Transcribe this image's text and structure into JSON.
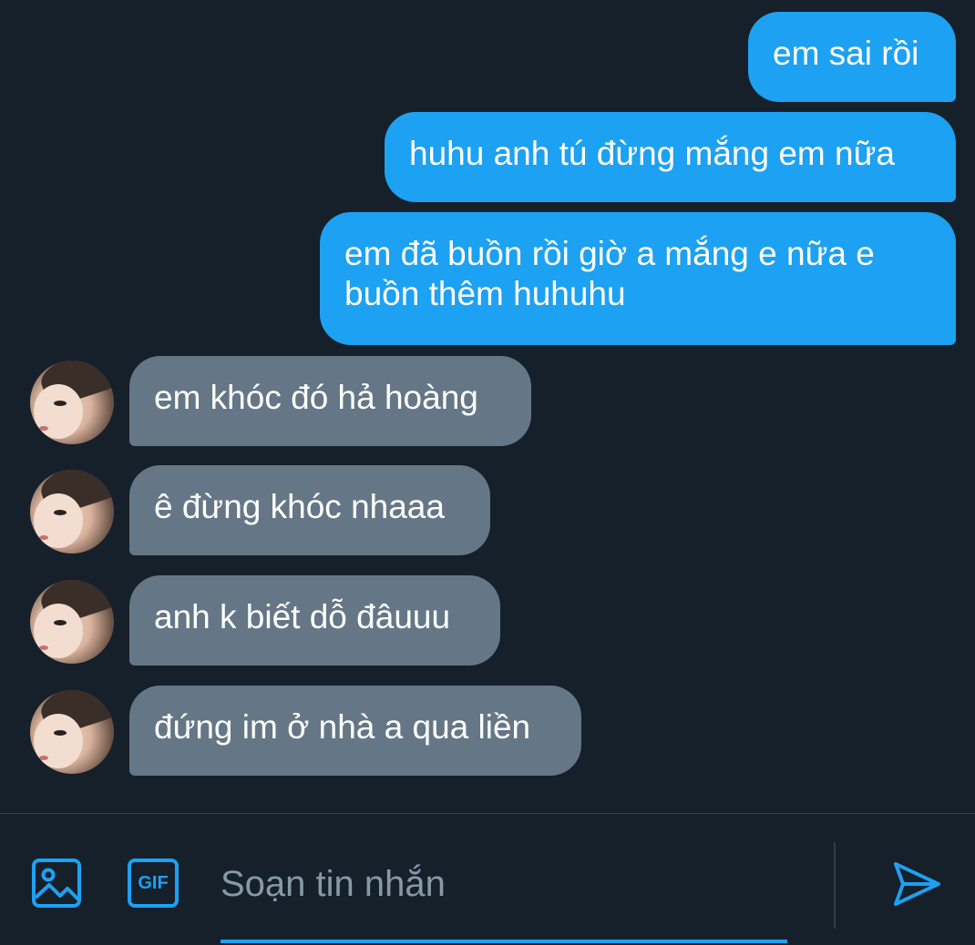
{
  "conversation": {
    "sent_messages": [
      {
        "text": "em sai rồi"
      },
      {
        "text": "huhu anh tú đừng mắng em nữa"
      },
      {
        "line1": "em đã buồn rồi giờ a mắng e nữa e",
        "line2": "buồn thêm huhuhu"
      }
    ],
    "received_messages": [
      {
        "text": "em khóc đó hả hoàng"
      },
      {
        "text": "ê đừng khóc nhaaa"
      },
      {
        "text": "anh k biết dỗ đâuuu"
      },
      {
        "text": "đứng im ở nhà a qua liền"
      }
    ]
  },
  "composer": {
    "placeholder": "Soạn tin nhắn",
    "gif_label": "GIF",
    "image_icon": "image-icon",
    "send_icon": "send-icon"
  },
  "colors": {
    "background": "#15202b",
    "sent_bubble": "#1da1f2",
    "received_bubble": "#657786",
    "accent": "#1da1f2",
    "placeholder": "#8899a6"
  }
}
